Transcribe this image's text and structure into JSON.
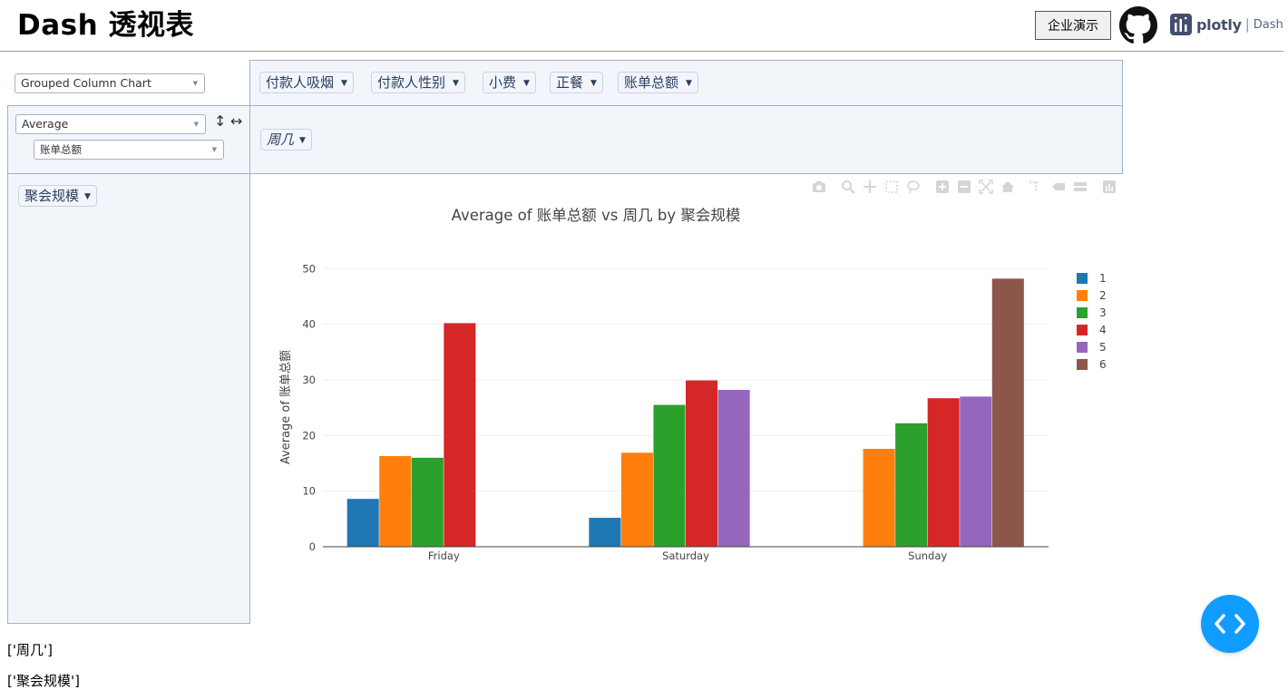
{
  "header": {
    "title": "Dash 透视表",
    "demo_button": "企业演示",
    "plotly_word": "plotly",
    "plotly_sep": "|",
    "plotly_dash": "Dash"
  },
  "pivot": {
    "renderer": "Grouped Column Chart",
    "aggregator": "Average",
    "aggregator_value": "账单总额",
    "sort_rows_arrow": "↕",
    "sort_cols_arrow": "↔",
    "unused_fields": [
      "付款人吸烟",
      "付款人性别",
      "小费",
      "正餐",
      "账单总额"
    ],
    "col_fields": [
      "周几"
    ],
    "row_fields": [
      "聚会规模"
    ]
  },
  "chart_data": {
    "type": "bar",
    "title": "Average of 账单总额 vs 周几 by 聚会规模",
    "xlabel": "",
    "ylabel": "Average of 账单总额",
    "categories": [
      "Friday",
      "Saturday",
      "Sunday"
    ],
    "ylim": [
      0,
      52
    ],
    "yticks": [
      0,
      10,
      20,
      30,
      40,
      50
    ],
    "grid": true,
    "legend_position": "right",
    "series": [
      {
        "name": "1",
        "color": "#1f77b4",
        "values": [
          8.6,
          5.2,
          null
        ]
      },
      {
        "name": "2",
        "color": "#ff7f0e",
        "values": [
          16.3,
          16.9,
          17.6
        ]
      },
      {
        "name": "3",
        "color": "#2ca02c",
        "values": [
          16.0,
          25.5,
          22.2
        ]
      },
      {
        "name": "4",
        "color": "#d62728",
        "values": [
          40.2,
          29.9,
          26.7
        ]
      },
      {
        "name": "5",
        "color": "#9467bd",
        "values": [
          null,
          28.2,
          27.0
        ]
      },
      {
        "name": "6",
        "color": "#8c564b",
        "values": [
          null,
          null,
          48.2
        ]
      }
    ]
  },
  "output": {
    "cols_text": "['周几']",
    "rows_text": "['聚会规模']"
  },
  "fab_label": "< >"
}
